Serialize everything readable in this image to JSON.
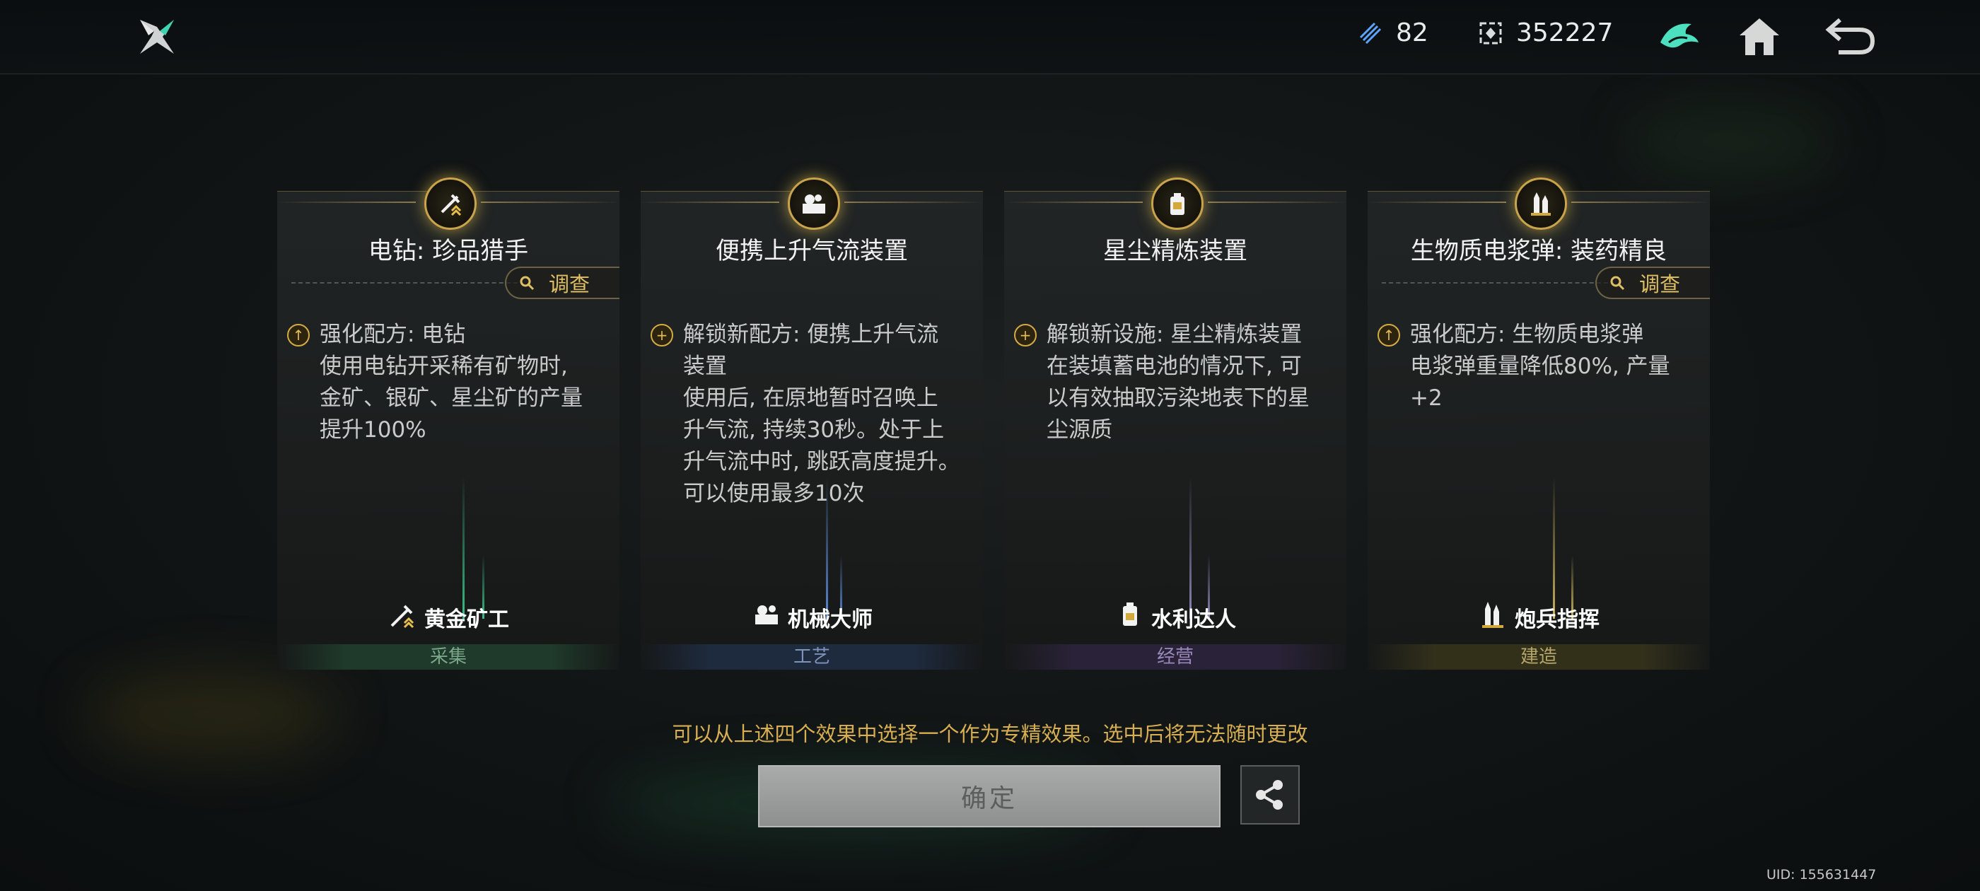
{
  "topbar": {
    "energy_value": "82",
    "currency_value": "352227"
  },
  "cards": [
    {
      "title": "电钻: 珍品猎手",
      "has_survey": true,
      "survey_label": "调查",
      "badge": "up",
      "desc": [
        "强化配方: 电钻",
        "使用电钻开采稀有矿物时,",
        "金矿、银矿、星尘矿的产量",
        "提升100%"
      ],
      "role_icon": "drill-icon",
      "role": "黄金矿工",
      "category": "采集",
      "category_color": "#1f3a2a",
      "category_text": "#7aa68a",
      "beam_color": "#3bbf8a"
    },
    {
      "title": "便携上升气流装置",
      "has_survey": false,
      "badge": "plus",
      "desc": [
        "解锁新配方: 便携上升气流",
        "装置",
        "使用后, 在原地暂时召唤上",
        "升气流, 持续30秒。处于上",
        "升气流中时, 跳跃高度提升。",
        "可以使用最多10次"
      ],
      "role_icon": "gear-machine-icon",
      "role": "机械大师",
      "category": "工艺",
      "category_color": "#1e2a3e",
      "category_text": "#7f93b8",
      "beam_color": "#5b88d6"
    },
    {
      "title": "星尘精炼装置",
      "has_survey": false,
      "badge": "plus",
      "desc": [
        "解锁新设施: 星尘精炼装置",
        "在装填蓄电池的情况下, 可",
        "以有效抽取污染地表下的星",
        "尘源质"
      ],
      "role_icon": "water-tank-icon",
      "role": "水利达人",
      "category": "经营",
      "category_color": "#2a2238",
      "category_text": "#9b88bb",
      "beam_color": "#8f86b8"
    },
    {
      "title": "生物质电浆弹: 装药精良",
      "has_survey": true,
      "survey_label": "调查",
      "badge": "up",
      "desc": [
        "强化配方: 生物质电浆弹",
        "电浆弹重量降低80%, 产量",
        "+2"
      ],
      "role_icon": "shells-icon",
      "role": "炮兵指挥",
      "category": "建造",
      "category_color": "#33301a",
      "category_text": "#b4a56a",
      "beam_color": "#c9b45a"
    }
  ],
  "hint": "可以从上述四个效果中选择一个作为专精效果。选中后将无法随时更改",
  "confirm_label": "确定",
  "uid": "UID: 155631447"
}
